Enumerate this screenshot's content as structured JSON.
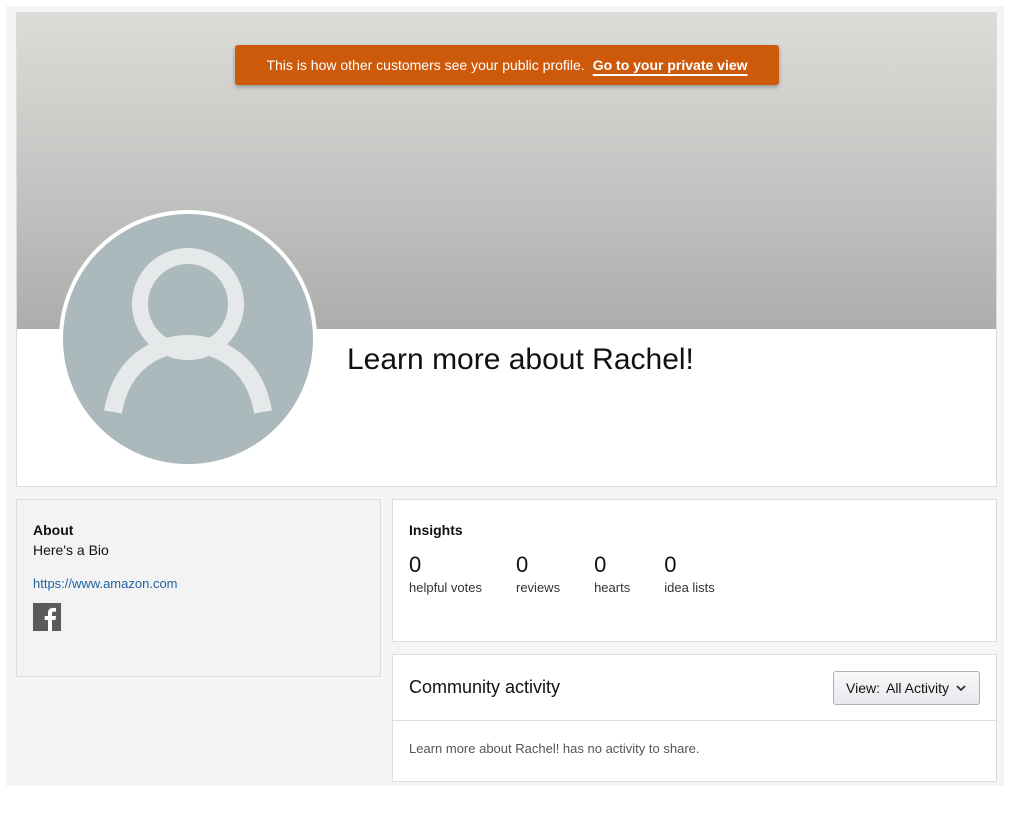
{
  "notice": {
    "text": "This is how other customers see your public profile.",
    "link": "Go to your private view"
  },
  "profile": {
    "title": "Learn more about Rachel!"
  },
  "about": {
    "heading": "About",
    "bio": "Here's a Bio",
    "link": "https://www.amazon.com",
    "social_icon": "facebook-icon"
  },
  "insights": {
    "heading": "Insights",
    "metrics": [
      {
        "value": "0",
        "label": "helpful votes"
      },
      {
        "value": "0",
        "label": "reviews"
      },
      {
        "value": "0",
        "label": "hearts"
      },
      {
        "value": "0",
        "label": "idea lists"
      }
    ]
  },
  "community": {
    "title": "Community activity",
    "view_label": "View:",
    "view_value": "All Activity",
    "empty_message": "Learn more about Rachel! has no activity to share."
  },
  "colors": {
    "notice_bg": "#cc5a0a",
    "link": "#2162a1",
    "avatar_bg": "#abb8bc"
  }
}
